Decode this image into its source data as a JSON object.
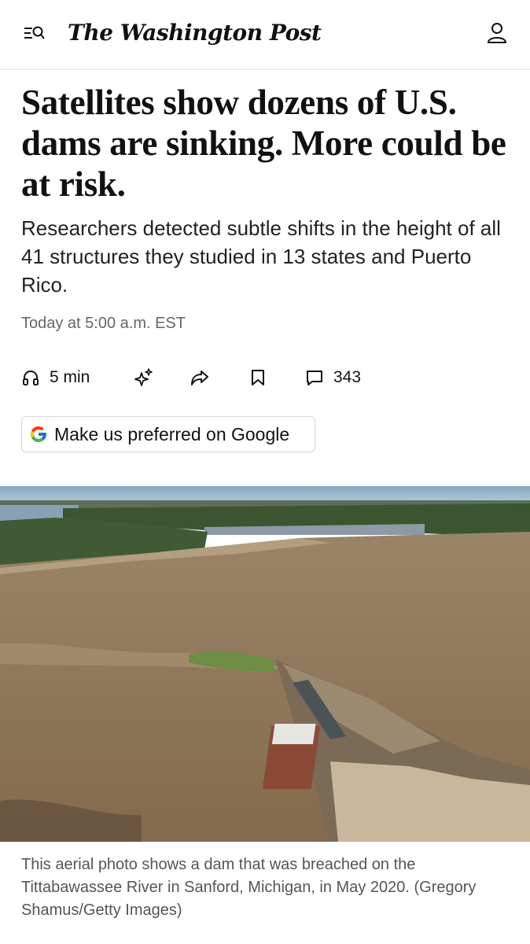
{
  "header": {
    "logo_text": "The Washington Post",
    "menu_icon": "search-menu-icon",
    "account_icon": "user-icon"
  },
  "article": {
    "headline": "Satellites show dozens of U.S. dams are sinking. More could be at risk.",
    "dek": "Researchers detected subtle shifts in the height of all 41 structures they studied in 13 states and Puerto Rico.",
    "timestamp": "Today at 5:00 a.m. EST"
  },
  "actions": {
    "listen_label": "5 min",
    "listen_icon": "headphones-icon",
    "summary_icon": "sparkles-icon",
    "share_icon": "share-icon",
    "save_icon": "bookmark-icon",
    "comments_icon": "comment-icon",
    "comments_count": "343"
  },
  "preferred": {
    "label": "Make us preferred on Google",
    "icon": "google-icon"
  },
  "photo": {
    "caption": "This aerial photo shows a dam that was breached on the Tittabawassee River in Sanford, Michigan, in May 2020. (Gregory Shamus/Getty Images)"
  },
  "colors": {
    "text": "#111111",
    "muted": "#666666",
    "water": "#8a7255",
    "sky": "#7fa3bf",
    "tree": "#3f5a33"
  }
}
